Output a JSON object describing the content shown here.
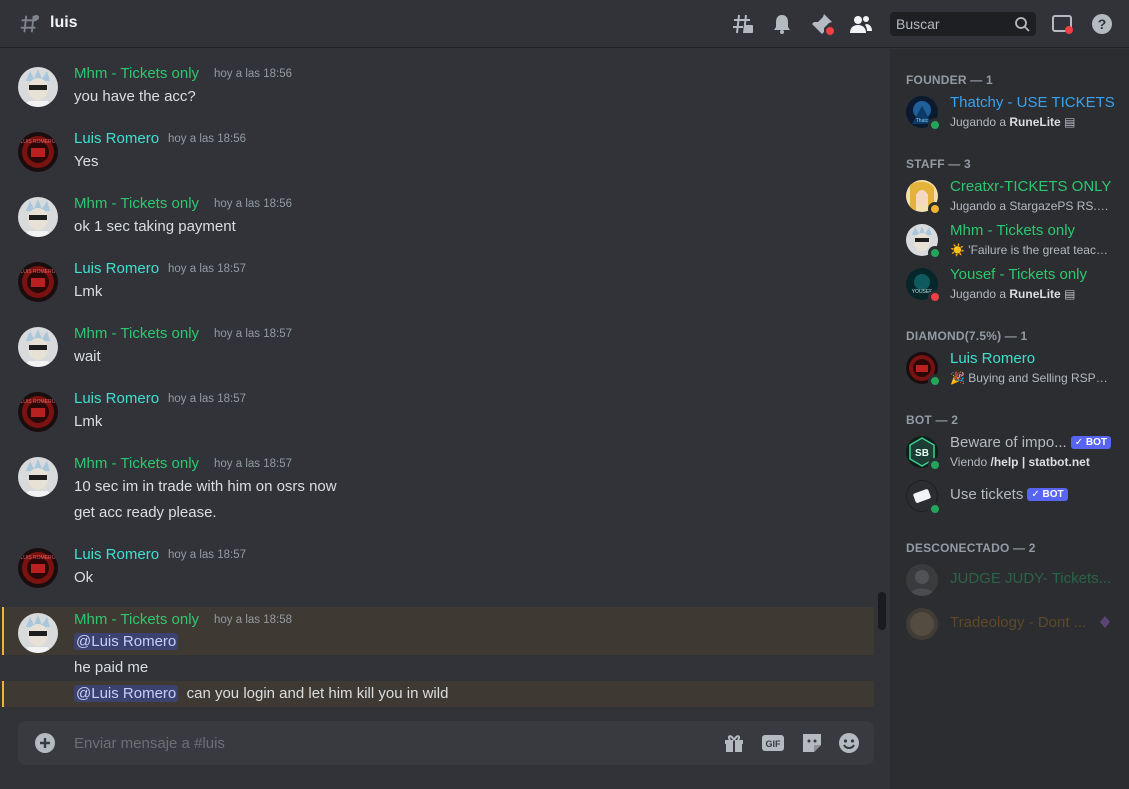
{
  "header": {
    "channel_name": "luis",
    "search_placeholder": "Buscar"
  },
  "messages": [
    {
      "author": "Mhm - Tickets only",
      "author_color": "#2dc770",
      "avatar": "rick",
      "time": "hoy a las 18:56",
      "lines": [
        "you have the acc?"
      ]
    },
    {
      "author": "Luis Romero",
      "author_color": "#3fe0d0",
      "avatar": "luis",
      "time": "hoy a las 18:56",
      "lines": [
        "Yes"
      ]
    },
    {
      "author": "Mhm - Tickets only",
      "author_color": "#2dc770",
      "avatar": "rick",
      "time": "hoy a las 18:56",
      "lines": [
        "ok 1 sec taking payment"
      ]
    },
    {
      "author": "Luis Romero",
      "author_color": "#3fe0d0",
      "avatar": "luis",
      "time": "hoy a las 18:57",
      "lines": [
        "Lmk"
      ]
    },
    {
      "author": "Mhm - Tickets only",
      "author_color": "#2dc770",
      "avatar": "rick",
      "time": "hoy a las 18:57",
      "lines": [
        "wait"
      ]
    },
    {
      "author": "Luis Romero",
      "author_color": "#3fe0d0",
      "avatar": "luis",
      "time": "hoy a las 18:57",
      "lines": [
        "Lmk"
      ]
    },
    {
      "author": "Mhm - Tickets only",
      "author_color": "#2dc770",
      "avatar": "rick",
      "time": "hoy a las 18:57",
      "lines": [
        "10 sec im in trade with him on osrs now",
        "get acc ready please."
      ]
    },
    {
      "author": "Luis Romero",
      "author_color": "#3fe0d0",
      "avatar": "luis",
      "time": "hoy a las 18:57",
      "lines": [
        "Ok"
      ]
    },
    {
      "author": "Mhm - Tickets only",
      "author_color": "#2dc770",
      "avatar": "rick",
      "time": "hoy a las 18:58",
      "mention": "@Luis Romero",
      "lines": [
        "he paid me"
      ],
      "mention2": "@Luis Romero",
      "line_after_mention2": "can you login and let him kill you in wild"
    }
  ],
  "composer": {
    "placeholder": "Enviar mensaje a #luis"
  },
  "members": {
    "founder": {
      "label": "FOUNDER — 1",
      "items": [
        {
          "name": "Thatchy - USE TICKETS",
          "color": "#3aa2f0",
          "activity_prefix": "Jugando a ",
          "activity_bold": "RuneLite",
          "status": "online"
        }
      ]
    },
    "staff": {
      "label": "STAFF — 3",
      "items": [
        {
          "name": "Creatxr-TICKETS ONLY",
          "color": "#2dc770",
          "activity_prefix": "Jugando a StargazePS RS...",
          "activity_bold": "",
          "status": "idle"
        },
        {
          "name": "Mhm - Tickets only",
          "color": "#2dc770",
          "activity_prefix": "☀️ 'Failure is the great teache...",
          "activity_bold": "",
          "status": "online"
        },
        {
          "name": "Yousef - Tickets only",
          "color": "#2dc770",
          "activity_prefix": "Jugando a ",
          "activity_bold": "RuneLite",
          "status": "dnd"
        }
      ]
    },
    "diamond": {
      "label": "DIAMOND(7.5%) — 1",
      "items": [
        {
          "name": "Luis Romero",
          "color": "#3fe0d0",
          "activity_prefix": "🎉 Buying and Selling RSPS a...",
          "activity_bold": "",
          "status": "online"
        }
      ]
    },
    "bot": {
      "label": "BOT — 2",
      "items": [
        {
          "name": "Beware of impo...",
          "color": "#b5bac1",
          "activity_prefix": "Viendo ",
          "activity_bold": "/help | statbot.net",
          "status": "online",
          "tag": "BOT"
        },
        {
          "name": "Use tickets",
          "color": "#b5bac1",
          "activity_prefix": "",
          "activity_bold": "",
          "status": "online",
          "tag": "BOT"
        }
      ]
    },
    "offline": {
      "label": "DESCONECTADO — 2",
      "items": [
        {
          "name": "JUDGE JUDY- Tickets...",
          "color": "#2dc770"
        },
        {
          "name": "Tradeology - Dont ...",
          "color": "#c27c0e"
        }
      ]
    }
  },
  "colors": {
    "bg": "#313338",
    "sidebar_bg": "#2b2d31",
    "green": "#2dc770",
    "cyan": "#3fe0d0",
    "mention_bar": "#f0b232",
    "bot_badge": "#5865f2"
  }
}
